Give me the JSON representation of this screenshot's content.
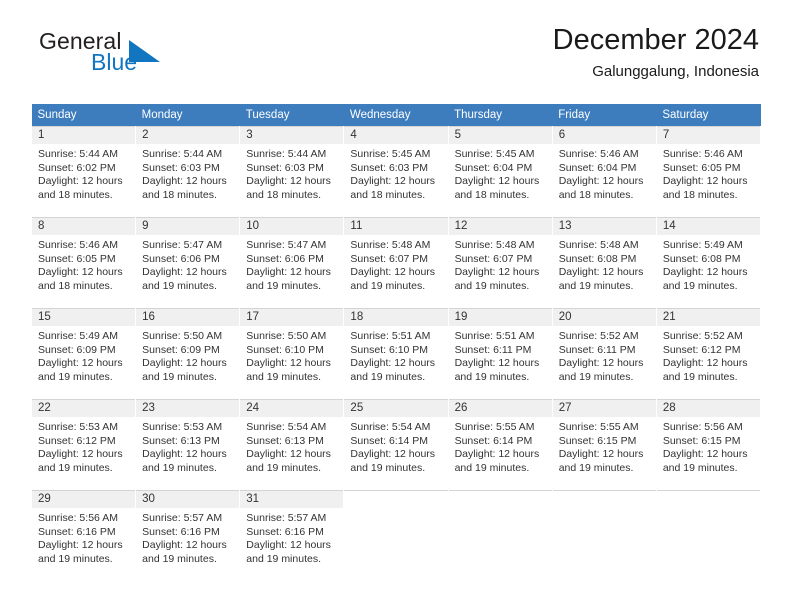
{
  "brand": {
    "name_part1": "General",
    "name_part2": "Blue",
    "logo_icon": "triangle-logo-icon",
    "accent_color": "#1175c0"
  },
  "header": {
    "title": "December 2024",
    "subtitle": "Galunggalung, Indonesia"
  },
  "calendar": {
    "header_bg_color": "#3d7cbd",
    "daynum_band_color": "#f0f0f0",
    "weekdays": [
      "Sunday",
      "Monday",
      "Tuesday",
      "Wednesday",
      "Thursday",
      "Friday",
      "Saturday"
    ],
    "weeks": [
      [
        {
          "day": "1",
          "lines": [
            "Sunrise: 5:44 AM",
            "Sunset: 6:02 PM",
            "Daylight: 12 hours",
            "and 18 minutes."
          ]
        },
        {
          "day": "2",
          "lines": [
            "Sunrise: 5:44 AM",
            "Sunset: 6:03 PM",
            "Daylight: 12 hours",
            "and 18 minutes."
          ]
        },
        {
          "day": "3",
          "lines": [
            "Sunrise: 5:44 AM",
            "Sunset: 6:03 PM",
            "Daylight: 12 hours",
            "and 18 minutes."
          ]
        },
        {
          "day": "4",
          "lines": [
            "Sunrise: 5:45 AM",
            "Sunset: 6:03 PM",
            "Daylight: 12 hours",
            "and 18 minutes."
          ]
        },
        {
          "day": "5",
          "lines": [
            "Sunrise: 5:45 AM",
            "Sunset: 6:04 PM",
            "Daylight: 12 hours",
            "and 18 minutes."
          ]
        },
        {
          "day": "6",
          "lines": [
            "Sunrise: 5:46 AM",
            "Sunset: 6:04 PM",
            "Daylight: 12 hours",
            "and 18 minutes."
          ]
        },
        {
          "day": "7",
          "lines": [
            "Sunrise: 5:46 AM",
            "Sunset: 6:05 PM",
            "Daylight: 12 hours",
            "and 18 minutes."
          ]
        }
      ],
      [
        {
          "day": "8",
          "lines": [
            "Sunrise: 5:46 AM",
            "Sunset: 6:05 PM",
            "Daylight: 12 hours",
            "and 18 minutes."
          ]
        },
        {
          "day": "9",
          "lines": [
            "Sunrise: 5:47 AM",
            "Sunset: 6:06 PM",
            "Daylight: 12 hours",
            "and 19 minutes."
          ]
        },
        {
          "day": "10",
          "lines": [
            "Sunrise: 5:47 AM",
            "Sunset: 6:06 PM",
            "Daylight: 12 hours",
            "and 19 minutes."
          ]
        },
        {
          "day": "11",
          "lines": [
            "Sunrise: 5:48 AM",
            "Sunset: 6:07 PM",
            "Daylight: 12 hours",
            "and 19 minutes."
          ]
        },
        {
          "day": "12",
          "lines": [
            "Sunrise: 5:48 AM",
            "Sunset: 6:07 PM",
            "Daylight: 12 hours",
            "and 19 minutes."
          ]
        },
        {
          "day": "13",
          "lines": [
            "Sunrise: 5:48 AM",
            "Sunset: 6:08 PM",
            "Daylight: 12 hours",
            "and 19 minutes."
          ]
        },
        {
          "day": "14",
          "lines": [
            "Sunrise: 5:49 AM",
            "Sunset: 6:08 PM",
            "Daylight: 12 hours",
            "and 19 minutes."
          ]
        }
      ],
      [
        {
          "day": "15",
          "lines": [
            "Sunrise: 5:49 AM",
            "Sunset: 6:09 PM",
            "Daylight: 12 hours",
            "and 19 minutes."
          ]
        },
        {
          "day": "16",
          "lines": [
            "Sunrise: 5:50 AM",
            "Sunset: 6:09 PM",
            "Daylight: 12 hours",
            "and 19 minutes."
          ]
        },
        {
          "day": "17",
          "lines": [
            "Sunrise: 5:50 AM",
            "Sunset: 6:10 PM",
            "Daylight: 12 hours",
            "and 19 minutes."
          ]
        },
        {
          "day": "18",
          "lines": [
            "Sunrise: 5:51 AM",
            "Sunset: 6:10 PM",
            "Daylight: 12 hours",
            "and 19 minutes."
          ]
        },
        {
          "day": "19",
          "lines": [
            "Sunrise: 5:51 AM",
            "Sunset: 6:11 PM",
            "Daylight: 12 hours",
            "and 19 minutes."
          ]
        },
        {
          "day": "20",
          "lines": [
            "Sunrise: 5:52 AM",
            "Sunset: 6:11 PM",
            "Daylight: 12 hours",
            "and 19 minutes."
          ]
        },
        {
          "day": "21",
          "lines": [
            "Sunrise: 5:52 AM",
            "Sunset: 6:12 PM",
            "Daylight: 12 hours",
            "and 19 minutes."
          ]
        }
      ],
      [
        {
          "day": "22",
          "lines": [
            "Sunrise: 5:53 AM",
            "Sunset: 6:12 PM",
            "Daylight: 12 hours",
            "and 19 minutes."
          ]
        },
        {
          "day": "23",
          "lines": [
            "Sunrise: 5:53 AM",
            "Sunset: 6:13 PM",
            "Daylight: 12 hours",
            "and 19 minutes."
          ]
        },
        {
          "day": "24",
          "lines": [
            "Sunrise: 5:54 AM",
            "Sunset: 6:13 PM",
            "Daylight: 12 hours",
            "and 19 minutes."
          ]
        },
        {
          "day": "25",
          "lines": [
            "Sunrise: 5:54 AM",
            "Sunset: 6:14 PM",
            "Daylight: 12 hours",
            "and 19 minutes."
          ]
        },
        {
          "day": "26",
          "lines": [
            "Sunrise: 5:55 AM",
            "Sunset: 6:14 PM",
            "Daylight: 12 hours",
            "and 19 minutes."
          ]
        },
        {
          "day": "27",
          "lines": [
            "Sunrise: 5:55 AM",
            "Sunset: 6:15 PM",
            "Daylight: 12 hours",
            "and 19 minutes."
          ]
        },
        {
          "day": "28",
          "lines": [
            "Sunrise: 5:56 AM",
            "Sunset: 6:15 PM",
            "Daylight: 12 hours",
            "and 19 minutes."
          ]
        }
      ],
      [
        {
          "day": "29",
          "lines": [
            "Sunrise: 5:56 AM",
            "Sunset: 6:16 PM",
            "Daylight: 12 hours",
            "and 19 minutes."
          ]
        },
        {
          "day": "30",
          "lines": [
            "Sunrise: 5:57 AM",
            "Sunset: 6:16 PM",
            "Daylight: 12 hours",
            "and 19 minutes."
          ]
        },
        {
          "day": "31",
          "lines": [
            "Sunrise: 5:57 AM",
            "Sunset: 6:16 PM",
            "Daylight: 12 hours",
            "and 19 minutes."
          ]
        },
        {
          "day": "",
          "lines": []
        },
        {
          "day": "",
          "lines": []
        },
        {
          "day": "",
          "lines": []
        },
        {
          "day": "",
          "lines": []
        }
      ]
    ]
  }
}
